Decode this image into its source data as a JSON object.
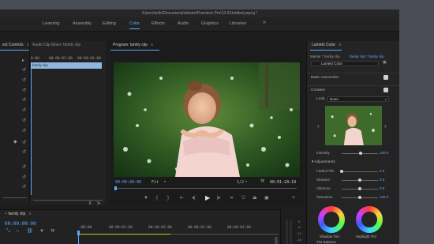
{
  "window": {
    "title": "\\Users\\kellri\\Documents\\Adobe\\Premiere Pro\\13.0\\Untitled.prproj *"
  },
  "workspaces": [
    {
      "label": "Learning",
      "active": false
    },
    {
      "label": "Assembly",
      "active": false
    },
    {
      "label": "Editing",
      "active": false
    },
    {
      "label": "Color",
      "active": true
    },
    {
      "label": "Effects",
      "active": false
    },
    {
      "label": "Audio",
      "active": false
    },
    {
      "label": "Graphics",
      "active": false
    },
    {
      "label": "Libraries",
      "active": false
    }
  ],
  "workspaces_more": "»",
  "left_panel": {
    "tab_label": "ect Controls"
  },
  "mixer_panel": {
    "tab_label": "Audio Clip Mixer: family clip",
    "ruler": [
      "0:00",
      "00:00:01:00",
      "00:00:02:00"
    ],
    "clip_label": "family clip"
  },
  "program": {
    "title": "Program: family clip",
    "timecode": "00:00:00:00",
    "zoom": "Fit",
    "resolution": "1/2",
    "duration": "00:01:28:10",
    "playhead_fraction": 0.0
  },
  "lumetri": {
    "title": "Lumetri Color",
    "master_label": "Master * family clip",
    "clip_label": "family clip * family clip",
    "effect_label": "Lumetri Color",
    "basic_correction": "Basic Correction",
    "basic_checked": true,
    "creative": "Creative",
    "creative_checked": true,
    "look_label": "Look",
    "look_value": "None",
    "intensity_label": "Intensity",
    "intensity_value": "100.0",
    "adjustments": "Adjustments",
    "sliders": [
      {
        "label": "Faded Film",
        "value": "0.0",
        "fraction": 0.0
      },
      {
        "label": "Sharpen",
        "value": "0.0",
        "fraction": 0.5
      },
      {
        "label": "Vibrance",
        "value": "0.0",
        "fraction": 0.5
      },
      {
        "label": "Saturation",
        "value": "100.0",
        "fraction": 0.5
      }
    ],
    "shadow_tint": "Shadow Tint",
    "highlight_tint": "Highlight Tint",
    "tint_balance": "Tint Balance"
  },
  "timeline": {
    "tab_label": "family clip",
    "timecode": "00:00:00:00",
    "ruler": [
      ":00:00",
      "00:00:01:00",
      "00:00:02:00",
      "00:00:03:00",
      "00:00:04:00"
    ]
  },
  "audio_meter": {
    "labels": [
      "0",
      "-6",
      "-12",
      "-18"
    ]
  },
  "colors": {
    "accent": "#5aa9ff",
    "panel": "#232323",
    "background": "#4a4d55"
  }
}
